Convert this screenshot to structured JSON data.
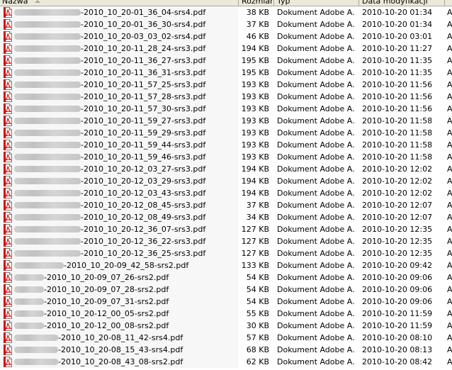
{
  "columns": {
    "name": "Nazwa",
    "size": "Rozmiar",
    "type": "Typ",
    "date": "Data modyfikacji"
  },
  "files": [
    {
      "name": "-2010_10_20-01_36_04-srs4.pdf",
      "size": "38 KB",
      "type": "Dokument Adobe A...",
      "date": "2010-10-20 01:34",
      "attr": "A"
    },
    {
      "name": "-2010_10_20-01_36_30-srs4.pdf",
      "size": "37 KB",
      "type": "Dokument Adobe A...",
      "date": "2010-10-20 01:34",
      "attr": "A"
    },
    {
      "name": "-2010_10_20-03_03_02-srs4.pdf",
      "size": "46 KB",
      "type": "Dokument Adobe A...",
      "date": "2010-10-20 03:01",
      "attr": "A"
    },
    {
      "name": "-2010_10_20-11_28_24-srs3.pdf",
      "size": "194 KB",
      "type": "Dokument Adobe A...",
      "date": "2010-10-20 11:27",
      "attr": "A"
    },
    {
      "name": "-2010_10_20-11_36_27-srs3.pdf",
      "size": "195 KB",
      "type": "Dokument Adobe A...",
      "date": "2010-10-20 11:35",
      "attr": "A"
    },
    {
      "name": "-2010_10_20-11_36_31-srs3.pdf",
      "size": "195 KB",
      "type": "Dokument Adobe A...",
      "date": "2010-10-20 11:35",
      "attr": "A"
    },
    {
      "name": "-2010_10_20-11_57_25-srs3.pdf",
      "size": "193 KB",
      "type": "Dokument Adobe A...",
      "date": "2010-10-20 11:56",
      "attr": "A"
    },
    {
      "name": "-2010_10_20-11_57_28-srs3.pdf",
      "size": "193 KB",
      "type": "Dokument Adobe A...",
      "date": "2010-10-20 11:56",
      "attr": "A"
    },
    {
      "name": "-2010_10_20-11_57_30-srs3.pdf",
      "size": "193 KB",
      "type": "Dokument Adobe A...",
      "date": "2010-10-20 11:56",
      "attr": "A"
    },
    {
      "name": "-2010_10_20-11_59_27-srs3.pdf",
      "size": "193 KB",
      "type": "Dokument Adobe A...",
      "date": "2010-10-20 11:58",
      "attr": "A"
    },
    {
      "name": "-2010_10_20-11_59_29-srs3.pdf",
      "size": "193 KB",
      "type": "Dokument Adobe A...",
      "date": "2010-10-20 11:58",
      "attr": "A"
    },
    {
      "name": "-2010_10_20-11_59_44-srs3.pdf",
      "size": "193 KB",
      "type": "Dokument Adobe A...",
      "date": "2010-10-20 11:58",
      "attr": "A"
    },
    {
      "name": "-2010_10_20-11_59_46-srs3.pdf",
      "size": "193 KB",
      "type": "Dokument Adobe A...",
      "date": "2010-10-20 11:58",
      "attr": "A"
    },
    {
      "name": "-2010_10_20-12_03_27-srs3.pdf",
      "size": "194 KB",
      "type": "Dokument Adobe A...",
      "date": "2010-10-20 12:02",
      "attr": "A"
    },
    {
      "name": "-2010_10_20-12_03_29-srs3.pdf",
      "size": "194 KB",
      "type": "Dokument Adobe A...",
      "date": "2010-10-20 12:02",
      "attr": "A"
    },
    {
      "name": "-2010_10_20-12_03_43-srs3.pdf",
      "size": "194 KB",
      "type": "Dokument Adobe A...",
      "date": "2010-10-20 12:02",
      "attr": "A"
    },
    {
      "name": "-2010_10_20-12_08_45-srs3.pdf",
      "size": "37 KB",
      "type": "Dokument Adobe A...",
      "date": "2010-10-20 12:07",
      "attr": "A"
    },
    {
      "name": "-2010_10_20-12_08_49-srs3.pdf",
      "size": "34 KB",
      "type": "Dokument Adobe A...",
      "date": "2010-10-20 12:07",
      "attr": "A"
    },
    {
      "name": "-2010_10_20-12_36_07-srs3.pdf",
      "size": "127 KB",
      "type": "Dokument Adobe A...",
      "date": "2010-10-20 12:35",
      "attr": "A"
    },
    {
      "name": "-2010_10_20-12_36_22-srs3.pdf",
      "size": "127 KB",
      "type": "Dokument Adobe A...",
      "date": "2010-10-20 12:35",
      "attr": "A"
    },
    {
      "name": "-2010_10_20-12_36_25-srs3.pdf",
      "size": "127 KB",
      "type": "Dokument Adobe A...",
      "date": "2010-10-20 12:35",
      "attr": "A"
    },
    {
      "name": "-2010_10_20-09_42_58-srs2.pdf",
      "size": "133 KB",
      "type": "Dokument Adobe A...",
      "date": "2010-10-20 09:42",
      "attr": "A"
    },
    {
      "name": "-2010_10_20-09_07_26-srs2.pdf",
      "size": "54 KB",
      "type": "Dokument Adobe A...",
      "date": "2010-10-20 09:06",
      "attr": "A"
    },
    {
      "name": "-2010_10_20-09_07_28-srs2.pdf",
      "size": "54 KB",
      "type": "Dokument Adobe A...",
      "date": "2010-10-20 09:06",
      "attr": "A"
    },
    {
      "name": "-2010_10_20-09_07_31-srs2.pdf",
      "size": "54 KB",
      "type": "Dokument Adobe A...",
      "date": "2010-10-20 09:06",
      "attr": "A"
    },
    {
      "name": "-2010_10_20-12_00_05-srs2.pdf",
      "size": "55 KB",
      "type": "Dokument Adobe A...",
      "date": "2010-10-20 11:59",
      "attr": "A"
    },
    {
      "name": "-2010_10_20-12_00_08-srs2.pdf",
      "size": "30 KB",
      "type": "Dokument Adobe A...",
      "date": "2010-10-20 11:59",
      "attr": "A"
    },
    {
      "name": "-2010_10_20-08_11_42-srs4.pdf",
      "size": "57 KB",
      "type": "Dokument Adobe A...",
      "date": "2010-10-20 08:10",
      "attr": "A"
    },
    {
      "name": "-2010_10_20-08_15_43-srs4.pdf",
      "size": "68 KB",
      "type": "Dokument Adobe A...",
      "date": "2010-10-20 08:13",
      "attr": "A"
    },
    {
      "name": "-2010_10_20-08_43_08-srs2.pdf",
      "size": "62 KB",
      "type": "Dokument Adobe A...",
      "date": "2010-10-20 08:42",
      "attr": "A"
    }
  ],
  "colors": {
    "header_bg": "#ece9d8",
    "sorted_column_bg": "#f7f7f7",
    "pdf_icon_red": "#cc1111"
  },
  "icons": {
    "file": "pdf-file-icon",
    "sort": "sort-ascending-icon"
  }
}
